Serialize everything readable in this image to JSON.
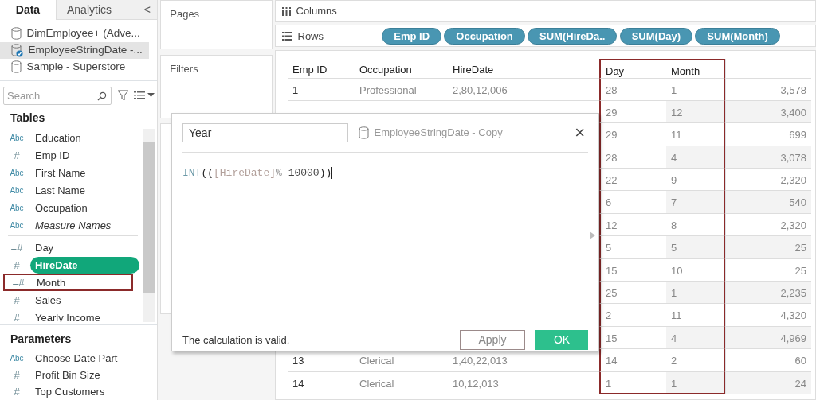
{
  "sidebar": {
    "tabs": [
      {
        "label": "Data",
        "selected": true
      },
      {
        "label": "Analytics",
        "selected": false
      }
    ],
    "collapse": "<",
    "sources": [
      {
        "label": "DimEmployee+ (Adve...",
        "selected": false
      },
      {
        "label": "EmployeeStringDate -...",
        "selected": true
      },
      {
        "label": "Sample - Superstore",
        "selected": false
      }
    ],
    "search": {
      "placeholder": "Search"
    },
    "tables_heading": "Tables",
    "field_groups": [
      [
        {
          "icon": "Abc",
          "label": "Education",
          "italic": false,
          "selected": false,
          "highlighted": false
        },
        {
          "icon": "#",
          "label": "Emp ID",
          "italic": false,
          "selected": false,
          "highlighted": false
        },
        {
          "icon": "Abc",
          "label": "First Name",
          "italic": false,
          "selected": false,
          "highlighted": false
        },
        {
          "icon": "Abc",
          "label": "Last Name",
          "italic": false,
          "selected": false,
          "highlighted": false
        },
        {
          "icon": "Abc",
          "label": "Occupation",
          "italic": false,
          "selected": false,
          "highlighted": false
        },
        {
          "icon": "Abc",
          "label": "Measure Names",
          "italic": true,
          "selected": false,
          "highlighted": false
        }
      ],
      [
        {
          "icon": "=#",
          "label": "Day",
          "italic": false,
          "selected": false,
          "highlighted": false
        },
        {
          "icon": "#",
          "label": "HireDate",
          "italic": false,
          "selected": true,
          "highlighted": false
        },
        {
          "icon": "=#",
          "label": "Month",
          "italic": false,
          "selected": false,
          "highlighted": true
        },
        {
          "icon": "#",
          "label": "Sales",
          "italic": false,
          "selected": false,
          "highlighted": false
        },
        {
          "icon": "#",
          "label": "Yearly Income",
          "italic": false,
          "selected": false,
          "highlighted": false
        }
      ]
    ],
    "parameters_heading": "Parameters",
    "parameters": [
      {
        "icon": "Abc",
        "label": "Choose Date Part"
      },
      {
        "icon": "#",
        "label": "Profit Bin Size"
      },
      {
        "icon": "#",
        "label": "Top Customers"
      }
    ]
  },
  "cards": {
    "pages": "Pages",
    "filters": "Filters"
  },
  "shelves": [
    {
      "label": "Columns",
      "kind": "columns"
    },
    {
      "label": "Rows",
      "kind": "rows",
      "pills": [
        "Emp ID",
        "Occupation",
        "SUM(HireDa..",
        "SUM(Day)",
        "SUM(Month)"
      ]
    }
  ],
  "table": {
    "columns": [
      {
        "label": "Emp ID",
        "highlighted": false
      },
      {
        "label": "Occupation",
        "highlighted": false
      },
      {
        "label": "HireDate",
        "highlighted": false
      },
      {
        "label": "Day",
        "highlighted": true
      },
      {
        "label": "Month",
        "highlighted": true
      },
      {
        "highlighted": false
      }
    ],
    "rows": [
      [
        "1",
        "Professional",
        "2,80,12,006",
        "28",
        "1",
        "3,578"
      ],
      [
        "",
        "",
        "",
        "29",
        "12",
        "3,400"
      ],
      [
        "",
        "",
        "",
        "29",
        "11",
        "699"
      ],
      [
        "",
        "",
        "",
        "28",
        "4",
        "3,078"
      ],
      [
        "",
        "",
        "",
        "22",
        "9",
        "2,320"
      ],
      [
        "",
        "",
        "",
        "6",
        "7",
        "540"
      ],
      [
        "",
        "",
        "",
        "12",
        "8",
        "2,320"
      ],
      [
        "",
        "",
        "",
        "5",
        "5",
        "25"
      ],
      [
        "",
        "",
        "",
        "15",
        "10",
        "25"
      ],
      [
        "",
        "",
        "",
        "25",
        "1",
        "2,235"
      ],
      [
        "",
        "",
        "",
        "2",
        "11",
        "4,320"
      ],
      [
        "",
        "",
        "",
        "15",
        "4",
        "4,969"
      ],
      [
        "13",
        "Clerical",
        "1,40,22,013",
        "14",
        "2",
        "60"
      ],
      [
        "14",
        "Clerical",
        "10,12,013",
        "1",
        "1",
        "24"
      ]
    ]
  },
  "dialog": {
    "name": "Year",
    "source": "EmployeeStringDate - Copy",
    "close": "×",
    "formula": [
      {
        "text": "INT",
        "kind": "function"
      },
      {
        "text": "((",
        "kind": "paren"
      },
      {
        "text": "[HireDate]",
        "kind": "field"
      },
      {
        "text": "%",
        "kind": "operator"
      },
      {
        "text": " 10000",
        "kind": "number"
      },
      {
        "text": "))",
        "kind": "paren"
      }
    ],
    "status": "The calculation is valid.",
    "buttons": [
      {
        "label": "Apply",
        "kind": "secondary"
      },
      {
        "label": "OK",
        "kind": "primary"
      }
    ]
  }
}
